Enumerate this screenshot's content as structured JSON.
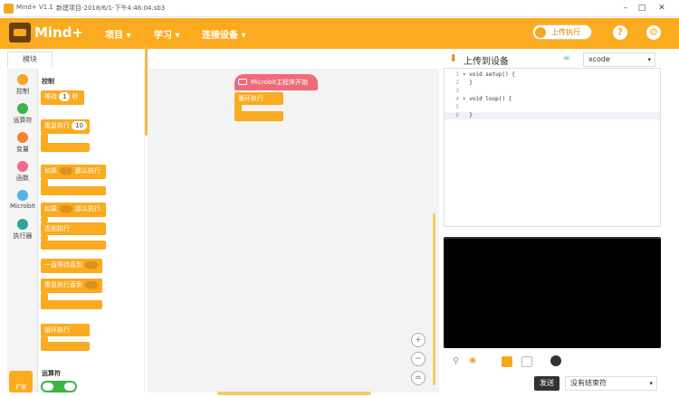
{
  "titlebar": {
    "app_name": "Mind+ V1.1",
    "project_title": "新建项目-2018/6/1-下午4:46:04.sb3",
    "min": "–",
    "max": "□",
    "close": "✕"
  },
  "header": {
    "logo": "Mind+",
    "menus": [
      {
        "label": "项目 ▾"
      },
      {
        "label": "学习 ▾"
      },
      {
        "label": "连接设备 ▾"
      }
    ],
    "upload_toggle_label": "上传执行",
    "help_icon": "?",
    "settings_icon": "⚙"
  },
  "left": {
    "tab": "模块",
    "categories": [
      {
        "label": "控制",
        "color": "#f5a623"
      },
      {
        "label": "运算符",
        "color": "#3cb44b"
      },
      {
        "label": "变量",
        "color": "#f58231"
      },
      {
        "label": "函数",
        "color": "#f36b8a"
      },
      {
        "label": "Microbit",
        "color": "#4db5e8"
      },
      {
        "label": "执行器",
        "color": "#2aa79b"
      }
    ],
    "extension_label": "扩展",
    "sections": {
      "control": "控制",
      "operators": "运算符"
    },
    "blocks": {
      "wait": "等待",
      "wait_value": "1",
      "wait_unit": "秒",
      "repeat": "重复执行",
      "repeat_value": "10",
      "if_then": "如果",
      "then": "那么执行",
      "if_then2": "如果",
      "then2": "那么执行",
      "else": "否则执行",
      "wait_until": "一直等待直到",
      "repeat_until": "重复执行直到",
      "forever": "循环执行"
    }
  },
  "workspace": {
    "hat_block": "Microbit主程序开始",
    "loop_block": "循环执行",
    "zoom_in": "+",
    "zoom_out": "−",
    "zoom_reset": "="
  },
  "right": {
    "upload_title": "上传到设备",
    "ide_select": "xcode",
    "code_lines": [
      {
        "n": "1",
        "t": "void setup() {"
      },
      {
        "n": "2",
        "t": "}"
      },
      {
        "n": "3",
        "t": ""
      },
      {
        "n": "4",
        "t": "void loop() {"
      },
      {
        "n": "5",
        "t": ""
      },
      {
        "n": "6",
        "t": "}"
      }
    ],
    "send_button": "发送",
    "line_ending": "没有结束符"
  }
}
